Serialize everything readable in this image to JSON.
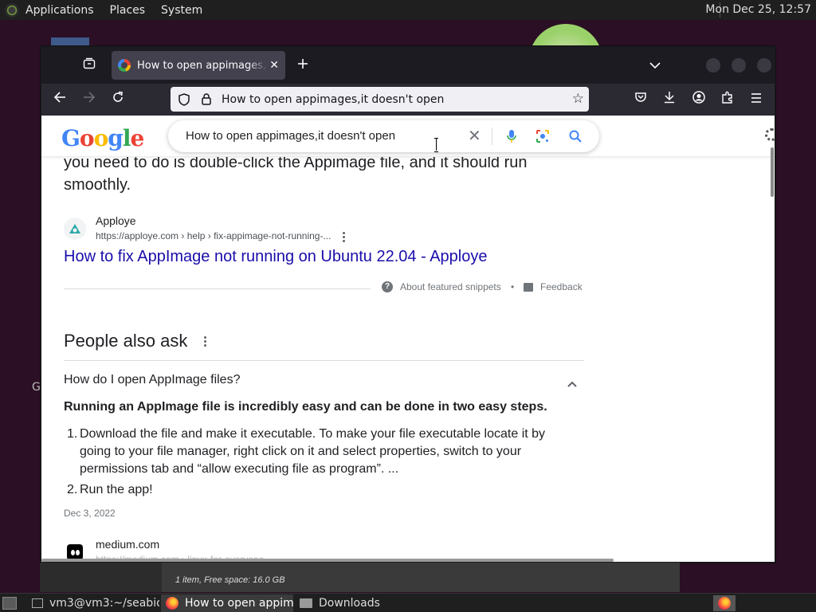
{
  "top_panel": {
    "menus": [
      "Applications",
      "Places",
      "System"
    ],
    "clock": "Mon Dec 25, 12:57"
  },
  "desktop": {
    "partial_label": "G"
  },
  "browser": {
    "tab": {
      "title": "How to open appimages,it doesn't open"
    },
    "url": "How to open appimages,it doesn't open"
  },
  "google": {
    "logo_text": "Google",
    "search_query": "How to open appimages,it doesn't open"
  },
  "snippet": {
    "continuation": "you need to do is double-click the Appimage file, and it should run smoothly."
  },
  "result1": {
    "site_name": "Apploye",
    "url": "https://apploye.com › help › fix-appimage-not-running-...",
    "title": "How to fix AppImage not running on Ubuntu 22.04 - Apploye"
  },
  "featured": {
    "about_label": "About featured snippets",
    "separator": "•",
    "feedback_label": "Feedback"
  },
  "paa": {
    "title": "People also ask",
    "question": "How do I open AppImage files?",
    "answer_bold": "Running an AppImage file is incredibly easy and can be done in two easy steps.",
    "steps": [
      {
        "num": "1.",
        "text": "Download the file and make it executable. To make your file executable locate it by going to your file manager, right click on it and select properties, switch to your permissions tab and “allow executing file as program”. ..."
      },
      {
        "num": "2.",
        "text": "Run the app!"
      }
    ],
    "date": "Dec 3, 2022"
  },
  "result2": {
    "site_name": "medium.com",
    "url": "https://medium.com › linux-for-everyone"
  },
  "file_manager": {
    "status": "1 item, Free space: 16.0 GB"
  },
  "taskbar": {
    "items": [
      {
        "label": "vm3@vm3:~/seabio..."
      },
      {
        "label": "How to open appim..."
      },
      {
        "label": "Downloads"
      }
    ]
  },
  "colors": {
    "link": "#1a0dab",
    "browser_chrome": "#2b2a33",
    "tabbar": "#1c1b22",
    "desktop": "#2b0f24"
  },
  "icons": [
    "tab-overview-icon",
    "google-favicon",
    "close-icon",
    "plus-icon",
    "chevron-down-icon",
    "back-arrow-icon",
    "forward-arrow-icon",
    "reload-icon",
    "shield-icon",
    "lock-icon",
    "star-icon",
    "pocket-icon",
    "download-icon",
    "account-icon",
    "extensions-icon",
    "menu-icon",
    "mic-icon",
    "lens-icon",
    "search-icon",
    "gear-icon",
    "question-icon",
    "feedback-icon",
    "more-vert-icon",
    "chevron-up-icon"
  ]
}
